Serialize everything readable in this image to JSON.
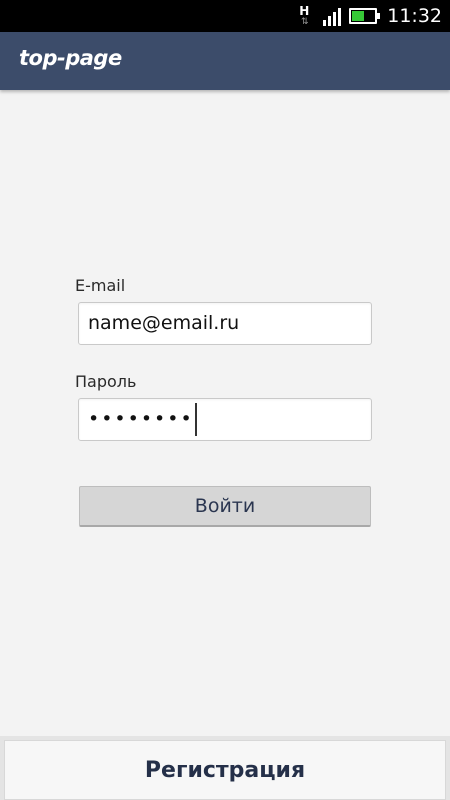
{
  "status_bar": {
    "network_type": "H",
    "network_arrows": "⇅",
    "time": "11:32",
    "signal_bars": 4,
    "battery_level": 0.55,
    "battery_color": "#37c837"
  },
  "header": {
    "logo_text": "top-page",
    "background_color": "#3c4c6a"
  },
  "login_form": {
    "email": {
      "label": "E-mail",
      "value": "name@email.ru"
    },
    "password": {
      "label": "Пароль",
      "masked_value": "••••••••"
    },
    "submit_label": "Войти"
  },
  "footer": {
    "register_label": "Регистрация"
  }
}
